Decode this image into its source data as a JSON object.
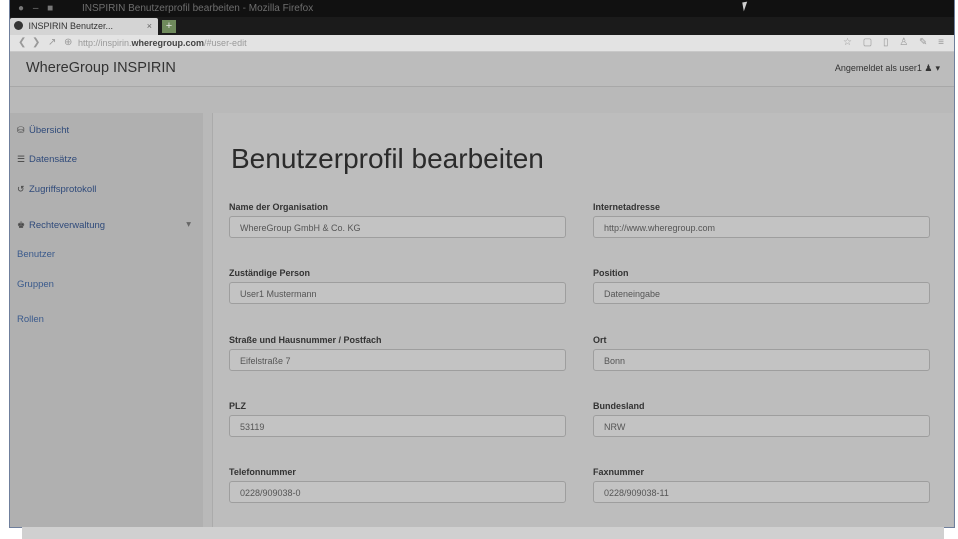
{
  "browser": {
    "window_title": "INSPIRIN Benutzerprofil bearbeiten - Mozilla Firefox",
    "tab_label": "INSPIRIN Benutzer...",
    "tab_close": "×",
    "new_tab": "+",
    "url_prefix": "http://inspirin.",
    "url_domain": "wheregroup.com",
    "url_path": "/#user-edit",
    "nav_right_icons": "☆ ▢ ▯ ♙ ✎ ≡"
  },
  "app": {
    "brand": "WhereGroup INSPIRIN",
    "user_label": "Angemeldet als user1"
  },
  "sidebar": {
    "items": [
      {
        "label": "Übersicht",
        "icon": "dashboard-icon"
      },
      {
        "label": "Datensätze",
        "icon": "list-icon"
      },
      {
        "label": "Zugriffsprotokoll",
        "icon": "history-icon"
      },
      {
        "label": "Rechteverwaltung",
        "icon": "users-icon"
      },
      {
        "label": "Benutzer"
      },
      {
        "label": "Gruppen"
      },
      {
        "label": "Rollen"
      }
    ]
  },
  "main": {
    "title": "Benutzerprofil bearbeiten",
    "fields": [
      {
        "label": "Name der Organisation",
        "value": "WhereGroup GmbH & Co. KG"
      },
      {
        "label": "Internetadresse",
        "value": "http://www.wheregroup.com"
      },
      {
        "label": "Zuständige Person",
        "value": "User1 Mustermann"
      },
      {
        "label": "Position",
        "value": "Dateneingabe"
      },
      {
        "label": "Straße und Hausnummer / Postfach",
        "value": "Eifelstraße 7"
      },
      {
        "label": "Ort",
        "value": "Bonn"
      },
      {
        "label": "PLZ",
        "value": "53119"
      },
      {
        "label": "Bundesland",
        "value": "NRW"
      },
      {
        "label": "Telefonnummer",
        "value": "0228/909038-0"
      },
      {
        "label": "Faxnummer",
        "value": "0228/909038-11"
      }
    ]
  }
}
